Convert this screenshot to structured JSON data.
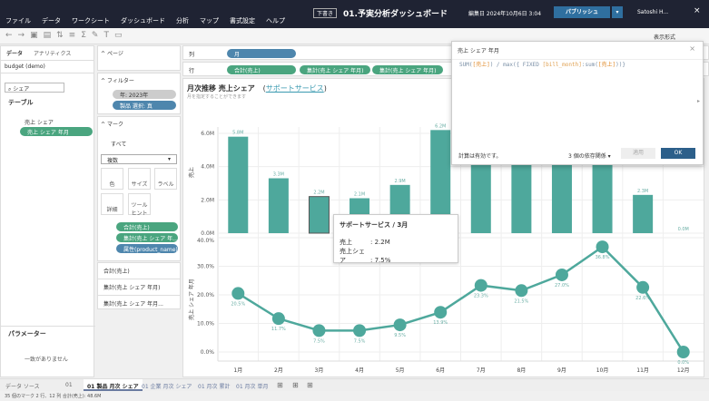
{
  "header": {
    "draft_badge": "下書き",
    "title": "01.予実分析ダッシュボード",
    "edited": "編集日 2024年10月6日 3:04",
    "publish": "パブリッシュ",
    "user": "Satoshi H...",
    "close": "×"
  },
  "menu": [
    "ファイル",
    "データ",
    "ワークシート",
    "ダッシュボード",
    "分析",
    "マップ",
    "書式設定",
    "ヘルプ"
  ],
  "toolbar": {
    "format_label": "表示形式"
  },
  "data_pane": {
    "tabs": [
      "データ",
      "アナリティクス"
    ],
    "datasource": "budget (demo)",
    "search": "シェア",
    "section": "テーブル",
    "fields": [
      "売上 シェア",
      "売上 シェア 年月"
    ],
    "params_title": "パラメーター",
    "params_empty": "一致がありません"
  },
  "cards": {
    "pages": "ページ",
    "filters_title": "フィルター",
    "filters": [
      "年: 2023年",
      "製品 選択: 真"
    ],
    "marks_title": "マーク",
    "marks_all": "すべて",
    "mark_type": "複数",
    "mark_buttons": [
      "色",
      "サイズ",
      "ラベル",
      "詳細",
      "ツールヒント"
    ],
    "mark_fields": [
      "合計(売上)",
      "集計(売上 シェア 年...",
      "属性(product_name)"
    ],
    "measures": [
      "合計(売上)",
      "集計(売上 シェア 年月)",
      "集計(売上 シェア 年月..."
    ]
  },
  "shelves": {
    "columns_label": "列",
    "rows_label": "行",
    "columns": [
      "月"
    ],
    "rows": [
      "合計(売上)",
      "集計(売上 シェア 年月)",
      "集計(売上 シェア 年月)"
    ]
  },
  "sheet": {
    "title": "月次推移 売上シェア",
    "title_paren_open": "(",
    "title_link": "サポートサービス",
    "title_paren_close": ")",
    "subtitle": "月を指定することができます"
  },
  "chart_data": {
    "type": "bar+line",
    "categories": [
      "1月",
      "2月",
      "3月",
      "4月",
      "5月",
      "6月",
      "7月",
      "8月",
      "9月",
      "10月",
      "11月",
      "12月"
    ],
    "bar": {
      "ylabel": "売上",
      "ylim": [
        0,
        6.2
      ],
      "ticks": [
        "0.0M",
        "2.0M",
        "4.0M",
        "6.0M"
      ],
      "values": [
        5.8,
        3.3,
        2.2,
        2.1,
        2.9,
        6.2,
        5.6,
        6.0,
        5.8,
        6.4,
        2.3,
        0.0
      ],
      "labels": [
        "5.8M",
        "3.3M",
        "2.2M",
        "2.1M",
        "2.9M",
        "6.2M",
        "",
        "",
        "",
        "",
        "2.3M",
        "0.0M"
      ]
    },
    "line": {
      "ylabel": "売上 シェア 年月",
      "ylim": [
        0,
        40
      ],
      "ticks": [
        "0.0%",
        "10.0%",
        "20.0%",
        "30.0%",
        "40.0%"
      ],
      "values": [
        20.5,
        11.7,
        7.5,
        7.5,
        9.5,
        13.9,
        23.3,
        21.5,
        27.0,
        36.8,
        22.6,
        0.0
      ],
      "labels": [
        "20.5%",
        "11.7%",
        "7.5%",
        "7.5%",
        "9.5%",
        "13.9%",
        "23.3%",
        "21.5%",
        "27.0%",
        "36.8%",
        "22.6%",
        "0.0%"
      ]
    },
    "color": "#4ea89c",
    "grid": true
  },
  "tooltip": {
    "title": "サポートサービス / 3月",
    "rows": [
      {
        "k": "売上",
        "v": ": 2.2M"
      },
      {
        "k": "売上シェア",
        "v": ": 7.5%"
      }
    ]
  },
  "calc": {
    "title": "売上 シェア 年月",
    "formula_parts": [
      "SUM(",
      "[売上]",
      ") / max({ FIXED ",
      "[bill_month]",
      ":sum(",
      "[売上]",
      "))}"
    ],
    "status": "計算は有効です。",
    "deps": "3 個の依存関係 ▾",
    "apply": "適用",
    "ok": "OK"
  },
  "tabs": {
    "datasource": "データ ソース",
    "sheets": [
      "01",
      "01 製品 月次 シェア",
      "01 企業 月次 シェア",
      "01 月次 累計",
      "01 月次 単月"
    ]
  },
  "status": "35 個のマーク  2 行、12 列  合計(売上): 48.6M"
}
